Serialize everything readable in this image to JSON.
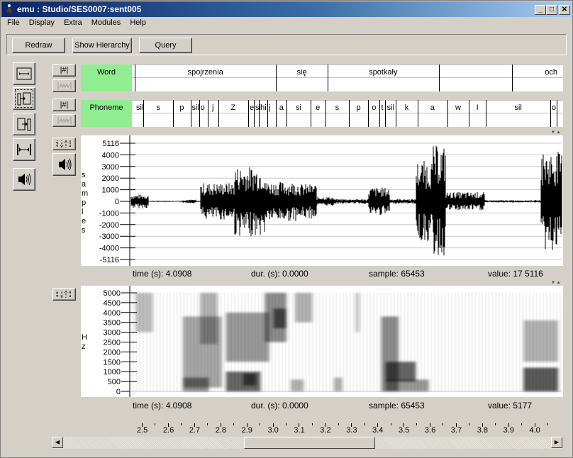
{
  "window": {
    "title": "emu : Studio/SES0007:sent005",
    "controls": {
      "minimize": "_",
      "maximize": "□",
      "close": "✕"
    }
  },
  "menu": [
    "File",
    "Display",
    "Extra",
    "Modules",
    "Help"
  ],
  "toolbar": {
    "redraw": "Redraw",
    "show_hierarchy": "Show Hierarchy",
    "query": "Query"
  },
  "side_buttons": [
    "zoom-fit-icon",
    "align-left-icon",
    "align-right-icon",
    "expand-width-icon",
    "play-sound-icon"
  ],
  "tier_buttons": {
    "hash": "|#|",
    "wave": "|∿|"
  },
  "tiers": [
    {
      "name": "Word",
      "segments": [
        {
          "label": "",
          "end": 0.0
        },
        {
          "label": "spojrzenia",
          "end": 0.33
        },
        {
          "label": "się",
          "end": 0.45
        },
        {
          "label": "spotkały",
          "end": 0.71
        },
        {
          "label": "",
          "end": 0.88
        },
        {
          "label": "och",
          "end": 1.0
        }
      ]
    },
    {
      "name": "Phoneme",
      "segments": [
        {
          "label": "sil",
          "start": 0.0
        },
        {
          "label": "s",
          "start": 0.02
        },
        {
          "label": "p",
          "start": 0.09
        },
        {
          "label": "sil",
          "start": 0.13
        },
        {
          "label": "o",
          "start": 0.15
        },
        {
          "label": "j",
          "start": 0.17
        },
        {
          "label": "Z",
          "start": 0.195
        },
        {
          "label": "e",
          "start": 0.265
        },
        {
          "label": "si",
          "start": 0.278
        },
        {
          "label": "hi",
          "start": 0.29
        },
        {
          "label": "j",
          "start": 0.31
        },
        {
          "label": "a",
          "start": 0.33
        },
        {
          "label": "si",
          "start": 0.355
        },
        {
          "label": "e",
          "start": 0.41
        },
        {
          "label": "s",
          "start": 0.445
        },
        {
          "label": "p",
          "start": 0.5
        },
        {
          "label": "o",
          "start": 0.545
        },
        {
          "label": "t",
          "start": 0.572
        },
        {
          "label": "sil",
          "start": 0.585
        },
        {
          "label": "k",
          "start": 0.61
        },
        {
          "label": "a",
          "start": 0.66
        },
        {
          "label": "w",
          "start": 0.73
        },
        {
          "label": "I",
          "start": 0.78
        },
        {
          "label": "sil",
          "start": 0.82
        },
        {
          "label": "o",
          "start": 0.97
        }
      ]
    }
  ],
  "waveform": {
    "ylabel": "samples",
    "ticks": [
      "5116",
      "4000",
      "3000",
      "2000",
      "1000",
      "0",
      "-1000",
      "-2000",
      "-3000",
      "-4000",
      "-5116"
    ],
    "status": {
      "time": "time (s):  4.0908",
      "dur": "dur. (s):  0.0000",
      "sample": "sample:  65453",
      "value": "value:  17 5116"
    }
  },
  "spectrogram": {
    "ylabel": "Hz",
    "ticks": [
      "5000",
      "4500",
      "4000",
      "3500",
      "3000",
      "2500",
      "2000",
      "1500",
      "1000",
      "500",
      "0"
    ],
    "status": {
      "time": "time (s):  4.0908",
      "dur": "dur. (s):  0.0000",
      "sample": "sample:  65453",
      "value": "value:    5177"
    }
  },
  "time_axis": {
    "ticks": [
      "2.5",
      "2.6",
      "2.7",
      "2.8",
      "2.9",
      "3.0",
      "3.1",
      "3.2",
      "3.3",
      "3.4",
      "3.5",
      "3.6",
      "3.7",
      "3.8",
      "3.9",
      "4.0"
    ]
  },
  "scrollbar": {
    "position": 0.37,
    "visible_fraction": 0.27
  }
}
